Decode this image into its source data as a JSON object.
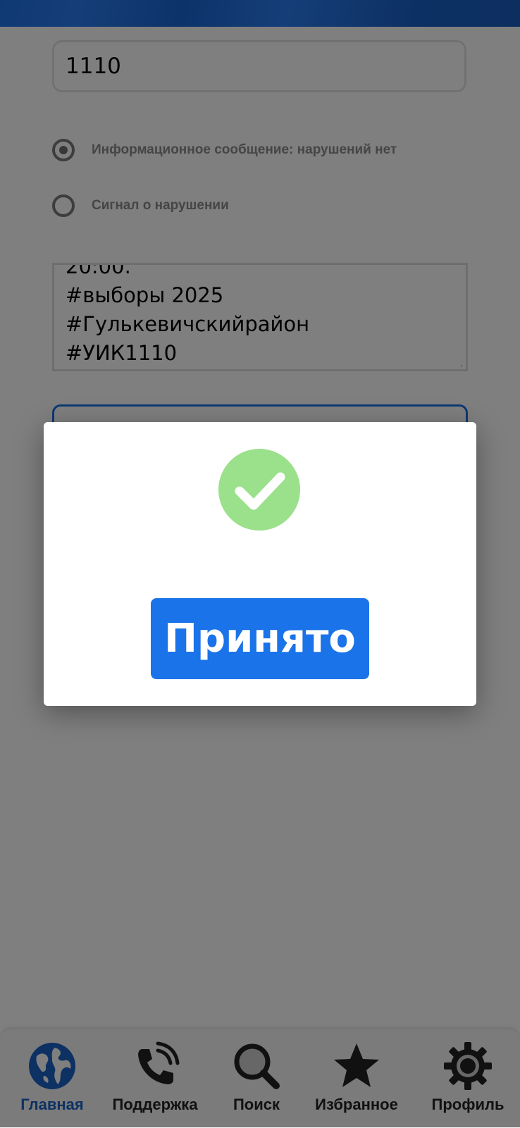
{
  "form": {
    "uik_value": "1110",
    "radio_info_label": "Информационное сообщение: нарушений нет",
    "radio_info_checked": true,
    "radio_violation_label": "Сигнал о нарушении",
    "radio_violation_checked": false,
    "message_lines": [
      "20:00.",
      "#выборы 2025",
      "#Гулькевичскийрайон",
      "#УИК1110"
    ]
  },
  "dialog": {
    "icon": "check-circle-icon",
    "accept_label": "Принято"
  },
  "nav": {
    "items": [
      {
        "label": "Главная",
        "icon": "globe-icon",
        "active": true
      },
      {
        "label": "Поддержка",
        "icon": "phone-icon",
        "active": false
      },
      {
        "label": "Поиск",
        "icon": "search-icon",
        "active": false
      },
      {
        "label": "Избранное",
        "icon": "star-icon",
        "active": false
      },
      {
        "label": "Профиль",
        "icon": "gear-icon",
        "active": false
      }
    ]
  },
  "colors": {
    "accent": "#1a73e8",
    "success": "#9be08b",
    "active_nav": "#1a62c4"
  }
}
